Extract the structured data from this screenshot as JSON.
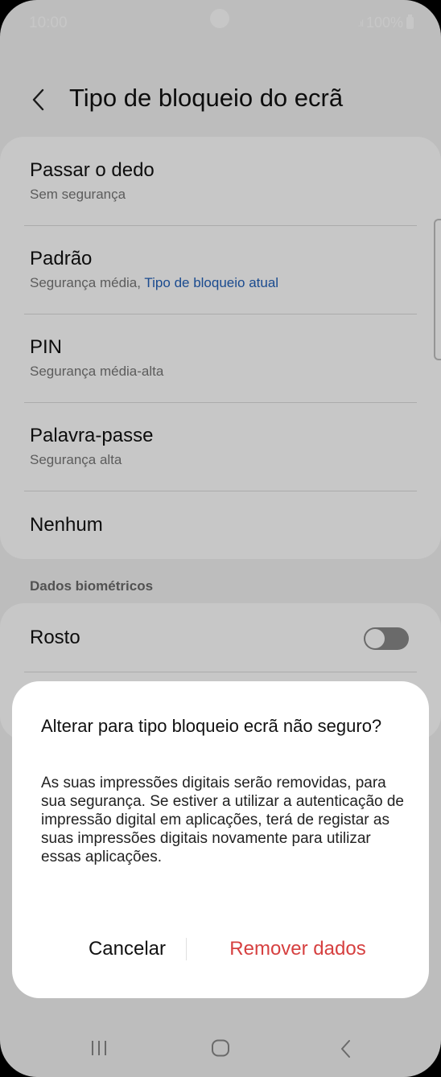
{
  "status_bar": {
    "time": "10:00",
    "signal": ".ıl",
    "battery": "100%"
  },
  "header": {
    "title": "Tipo de bloqueio do ecrã",
    "back_icon": "chevron-left-icon"
  },
  "lock_types": [
    {
      "title": "Passar o dedo",
      "subtitle": "Sem segurança"
    },
    {
      "title": "Padrão",
      "subtitle": "Segurança média, ",
      "subtitle_accent": "Tipo de bloqueio atual"
    },
    {
      "title": "PIN",
      "subtitle": "Segurança média-alta"
    },
    {
      "title": "Palavra-passe",
      "subtitle": "Segurança alta"
    },
    {
      "title": "Nenhum"
    }
  ],
  "biometrics": {
    "section_label": "Dados biométricos",
    "face_label": "Rosto",
    "face_enabled": false
  },
  "dialog": {
    "title": "Alterar para tipo bloqueio ecrã não seguro?",
    "body": "As suas impressões digitais serão removidas, para sua segurança. Se estiver a utilizar a autenticação de impressão digital em aplicações, terá de registar as suas impressões digitais novamente para utilizar essas aplicações.",
    "cancel_label": "Cancelar",
    "remove_label": "Remover dados"
  },
  "colors": {
    "accent": "#2361b8",
    "destructive": "#d64040"
  }
}
